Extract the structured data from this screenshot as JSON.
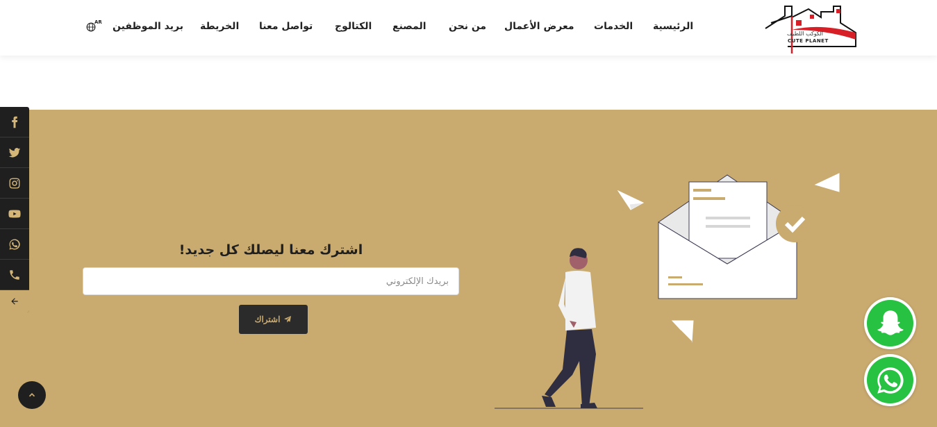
{
  "header": {
    "logo": {
      "arabic_name": "الكوكب اللطيف",
      "english_name": "CUTE PLANET"
    },
    "nav": [
      {
        "label": "الرئيسية"
      },
      {
        "label": "الخدمات"
      },
      {
        "label": "معرض الأعمال"
      },
      {
        "label": "من نحن"
      },
      {
        "label": "المصنع"
      },
      {
        "label": "الكتالوج"
      },
      {
        "label": "تواصل معنا"
      },
      {
        "label": "الخريطة"
      },
      {
        "label": "بريد الموظفين"
      }
    ],
    "language": {
      "code": "AR",
      "icon": "globe-icon"
    }
  },
  "social": {
    "items": [
      {
        "name": "facebook",
        "icon": "facebook-icon"
      },
      {
        "name": "twitter",
        "icon": "twitter-icon"
      },
      {
        "name": "instagram",
        "icon": "instagram-icon"
      },
      {
        "name": "youtube",
        "icon": "youtube-icon"
      },
      {
        "name": "whatsapp",
        "icon": "whatsapp-icon"
      },
      {
        "name": "phone",
        "icon": "phone-icon"
      }
    ],
    "toggle_icon": "arrow-left-icon"
  },
  "subscribe": {
    "title": "اشترك معنا ليصلك كل جديد!",
    "email_placeholder": "بريدك الإلكتروني",
    "button_label": "اشتراك",
    "button_icon": "paper-plane-icon"
  },
  "floating": {
    "snapchat_icon": "snapchat-icon",
    "whatsapp_icon": "whatsapp-icon"
  },
  "colors": {
    "band": "#c9aa6f",
    "dark": "#1f1f1f",
    "brand_red": "#d61f26",
    "whatsapp_green": "#27c241"
  }
}
